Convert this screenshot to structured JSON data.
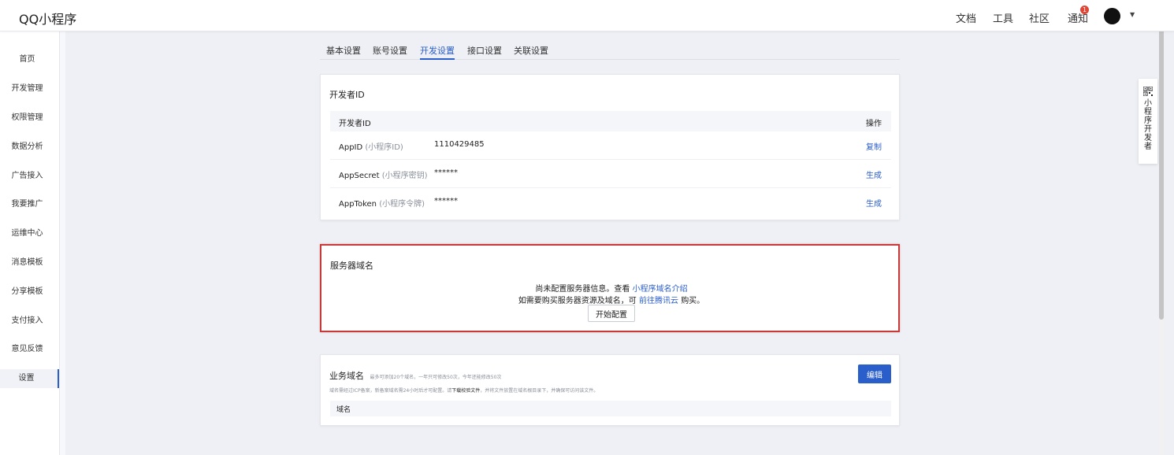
{
  "app": {
    "logo": "QQ小程序"
  },
  "topnav": {
    "docs": "文档",
    "tools": "工具",
    "community": "社区",
    "notify": "通知",
    "notify_count": "1"
  },
  "sidebar": {
    "items": [
      {
        "label": "首页"
      },
      {
        "label": "开发管理"
      },
      {
        "label": "权限管理"
      },
      {
        "label": "数据分析"
      },
      {
        "label": "广告接入"
      },
      {
        "label": "我要推广"
      },
      {
        "label": "运维中心"
      },
      {
        "label": "消息模板"
      },
      {
        "label": "分享模板"
      },
      {
        "label": "支付接入"
      },
      {
        "label": "意见反馈"
      },
      {
        "label": "设置"
      }
    ],
    "active": "设置"
  },
  "tabs": [
    {
      "label": "基本设置"
    },
    {
      "label": "账号设置"
    },
    {
      "label": "开发设置"
    },
    {
      "label": "接口设置"
    },
    {
      "label": "关联设置"
    }
  ],
  "active_tab": "开发设置",
  "dev_id": {
    "title": "开发者ID",
    "col_name": "开发者ID",
    "col_action": "操作",
    "rows": [
      {
        "name": "AppID",
        "hint": "(小程序ID)",
        "value": "1110429485",
        "action": "复制"
      },
      {
        "name": "AppSecret",
        "hint": "(小程序密钥)",
        "value": "******",
        "action": "生成"
      },
      {
        "name": "AppToken",
        "hint": "(小程序令牌)",
        "value": "******",
        "action": "生成"
      }
    ]
  },
  "server_domain": {
    "title": "服务器域名",
    "line1_prefix": "尚未配置服务器信息。查看",
    "line1_link": "小程序域名介绍",
    "line2_prefix": "如需要购买服务器资源及域名，可",
    "line2_link": "前往腾讯云",
    "line2_suffix": "购买。",
    "button": "开始配置"
  },
  "biz_domain": {
    "title": "业务域名",
    "note": "最多可添加20个域名，一年只可修改50次，今年还能修改50次",
    "desc_prefix": "域名需经过ICP备案，新备案域名需24小时后才可配置。请",
    "desc_link": "下载校验文件",
    "desc_suffix": "，并将文件放置在域名根目录下，并确保可访问该文件。",
    "col_domain": "域名",
    "edit_button": "编辑"
  },
  "float_panel": {
    "label": "小程序开发者"
  }
}
